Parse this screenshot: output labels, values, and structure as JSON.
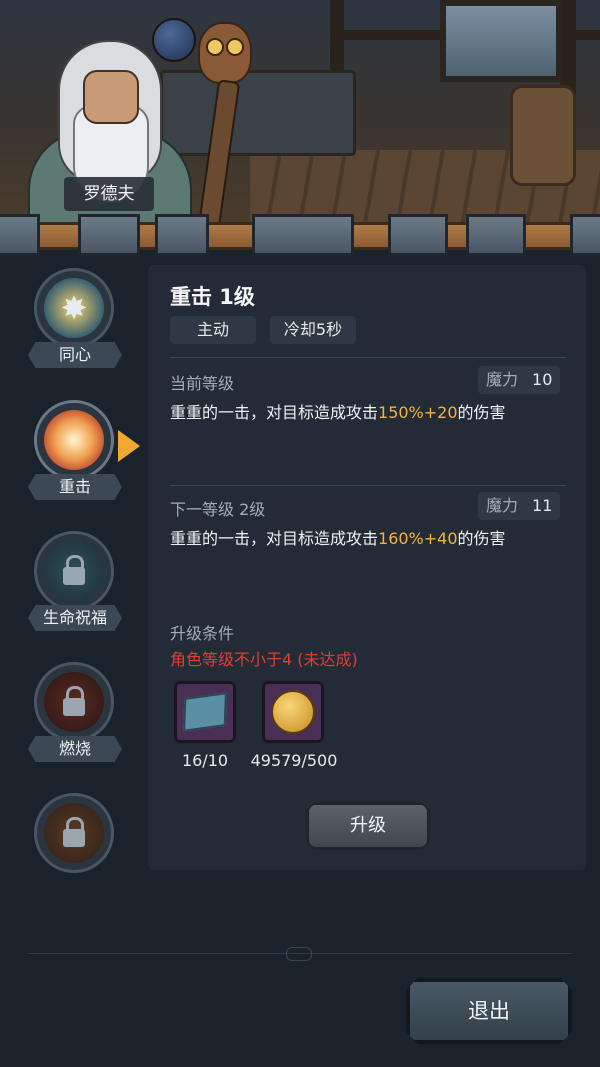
{
  "character": {
    "name": "罗德夫"
  },
  "skills": [
    {
      "label": "同心",
      "icon": "sun-icon",
      "locked": false
    },
    {
      "label": "重击",
      "icon": "burst-icon",
      "locked": false,
      "selected": true
    },
    {
      "label": "生命祝福",
      "icon": "lock-icon",
      "locked": true
    },
    {
      "label": "燃烧",
      "icon": "lock-icon",
      "locked": true
    },
    {
      "label": "",
      "icon": "lock-icon",
      "locked": true
    }
  ],
  "detail": {
    "title": "重击 1级",
    "type": "主动",
    "cooldown": "冷却5秒",
    "current": {
      "label": "当前等级",
      "mana_label": "魔力",
      "mana_value": "10",
      "desc_prefix": "重重的一击，对目标造成攻击",
      "desc_highlight": "150%+20",
      "desc_suffix": "的伤害"
    },
    "next": {
      "label": "下一等级 2级",
      "mana_label": "魔力",
      "mana_value": "11",
      "desc_prefix": "重重的一击，对目标造成攻击",
      "desc_highlight": "160%+40",
      "desc_suffix": "的伤害"
    },
    "upgrade_conditions": {
      "label": "升级条件",
      "requirement": "角色等级不小于4 (未达成)"
    },
    "materials": [
      {
        "icon": "map-scroll-icon",
        "count": "16/10"
      },
      {
        "icon": "gold-coin-icon",
        "count": "49579/500"
      }
    ],
    "upgrade_button": "升级"
  },
  "footer": {
    "exit_button": "退出"
  },
  "colors": {
    "highlight": "#f2b340",
    "warning": "#e53c32",
    "selected_arrow": "#f0a830"
  }
}
